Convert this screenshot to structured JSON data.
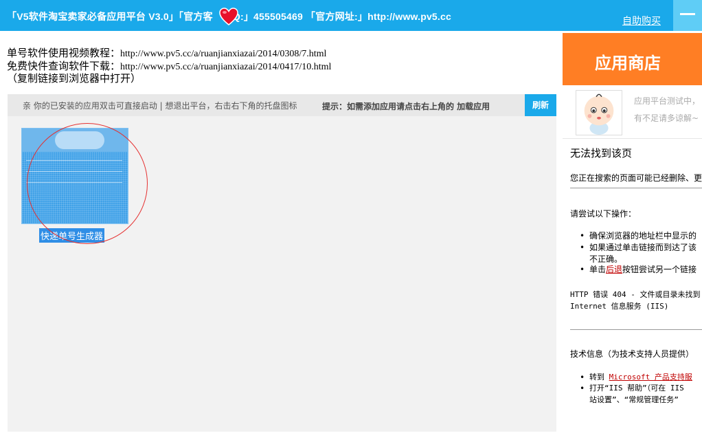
{
  "titlebar": {
    "title_part1": "「V5软件淘宝卖家必备应用平台 V3.0」「官方客",
    "title_part2": "QQ:」455505469 「官方网址:」http://www.pv5.cc",
    "buy_link": "自助购买"
  },
  "info": {
    "line1_label": "单号软件使用视频教程：",
    "line1_url": "http://www.pv5.cc/a/ruanjianxiazai/2014/0308/7.html",
    "line2_label": "免费快件查询软件下载：",
    "line2_url": "http://www.pv5.cc/a/ruanjianxiazai/2014/0417/10.html",
    "line3": "（复制链接到浏览器中打开）"
  },
  "hintbar": {
    "left": "亲  你的已安装的应用双击可直接启动 | 想退出平台，右击右下角的托盘图标",
    "right": "提示：如需添加应用请点击右上角的  加载应用",
    "refresh": "刷新"
  },
  "apps": [
    {
      "label": "快递单号生成器",
      "icon": "app-screenshot-thumbnail"
    }
  ],
  "store": {
    "header": "应用商店",
    "notice_line1": "应用平台测试中，",
    "notice_line2": "有不足请多谅解~"
  },
  "error_page": {
    "title": "无法找到该页",
    "desc": "您正在搜索的页面可能已经删除、更",
    "try_heading": "请尝试以下操作：",
    "item1": "确保浏览器的地址栏中显示的",
    "item2_line1": "如果通过单击链接而到达了该",
    "item2_line2": "不正确。",
    "item3_pre": "单击",
    "item3_link": "后退",
    "item3_post": "按钮尝试另一个链接",
    "http_line1": "HTTP 错误 404 - 文件或目录未找到",
    "http_line2": "Internet 信息服务 (IIS)",
    "tech_heading": "技术信息（为技术支持人员提供）",
    "tech1_pre": "转到 ",
    "tech1_link": "Microsoft 产品支持服",
    "tech2_line1": "打开“IIS 帮助”（可在 IIS",
    "tech2_line2": "站设置”、“常规管理任务”"
  },
  "colors": {
    "titlebar": "#1aa9ea",
    "store_header": "#ff7e24",
    "refresh_button": "#1aa9ea",
    "app_label": "#2f8ee6",
    "link_red": "#c00000"
  }
}
